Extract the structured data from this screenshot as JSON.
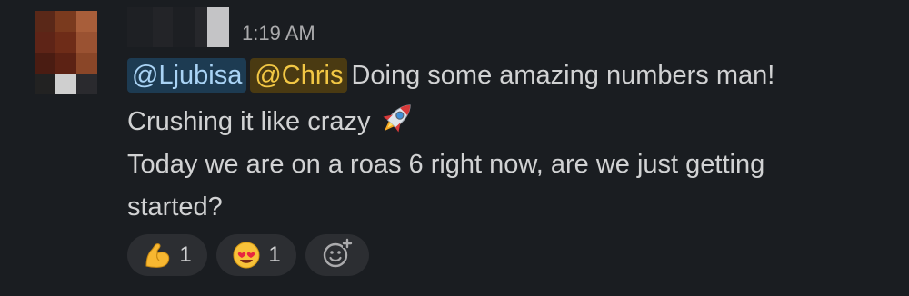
{
  "message": {
    "timestamp": "1:19 AM",
    "mentions": [
      "@Ljubisa",
      "@Chris"
    ],
    "line1_text": "Doing some amazing numbers man!",
    "line2_text": "Crushing it like crazy",
    "line3_text": "Today we are on a roas 6 right now, are we just getting",
    "line4_text": "started?",
    "inline_emoji": "rocket-icon"
  },
  "reactions": [
    {
      "emoji": "flexed-biceps-icon",
      "count": "1"
    },
    {
      "emoji": "heart-eyes-icon",
      "count": "1"
    }
  ],
  "add_reaction_icon": "add-reaction-icon",
  "colors": {
    "background": "#1a1d21",
    "mention_blue_bg": "#1d3b52",
    "mention_blue_text": "#a9d3f5",
    "mention_yellow_bg": "#4a3a12",
    "mention_yellow_text": "#f2c744"
  }
}
